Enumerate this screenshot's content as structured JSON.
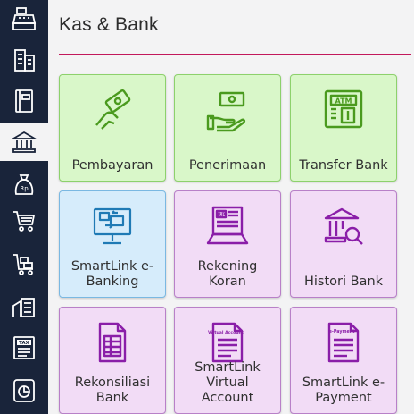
{
  "page": {
    "title": "Kas & Bank",
    "accent_color": "#c2185b"
  },
  "sidebar": {
    "background": "#19243a",
    "items": [
      {
        "icon": "cash-register-icon",
        "active": false
      },
      {
        "icon": "building-icon",
        "active": false
      },
      {
        "icon": "ledger-book-icon",
        "active": false
      },
      {
        "icon": "bank-icon",
        "active": true
      },
      {
        "icon": "money-bag-rp-icon",
        "active": false
      },
      {
        "icon": "shopping-cart-icon",
        "active": false
      },
      {
        "icon": "cart-box-icon",
        "active": false
      },
      {
        "icon": "warehouse-icon",
        "active": false
      },
      {
        "icon": "tax-document-icon",
        "active": false
      },
      {
        "icon": "report-chart-icon",
        "active": false
      }
    ]
  },
  "tiles": [
    {
      "label": "Pembayaran",
      "icon": "hand-money-icon",
      "color": "green"
    },
    {
      "label": "Penerimaan",
      "icon": "receive-money-icon",
      "color": "green"
    },
    {
      "label": "Transfer Bank",
      "icon": "atm-icon",
      "color": "green"
    },
    {
      "label": "SmartLink e-Banking",
      "icon": "monitor-banking-icon",
      "color": "blue"
    },
    {
      "label": "Rekening Koran",
      "icon": "bank-statement-icon",
      "color": "purple"
    },
    {
      "label": "Histori Bank",
      "icon": "bank-search-icon",
      "color": "purple"
    },
    {
      "label": "Rekonsiliasi Bank",
      "icon": "reconcile-document-icon",
      "color": "purple"
    },
    {
      "label": "SmartLink Virtual Account",
      "icon": "virtual-account-icon",
      "color": "purple"
    },
    {
      "label": "SmartLink e-Payment",
      "icon": "e-payment-icon",
      "color": "purple"
    }
  ],
  "icon_text": {
    "atm": "ATM",
    "rp": "RP",
    "rp_bag": "Rp",
    "tax": "TAX",
    "virtual_account": "Virtual Account",
    "e_payment": "e-Payment"
  }
}
